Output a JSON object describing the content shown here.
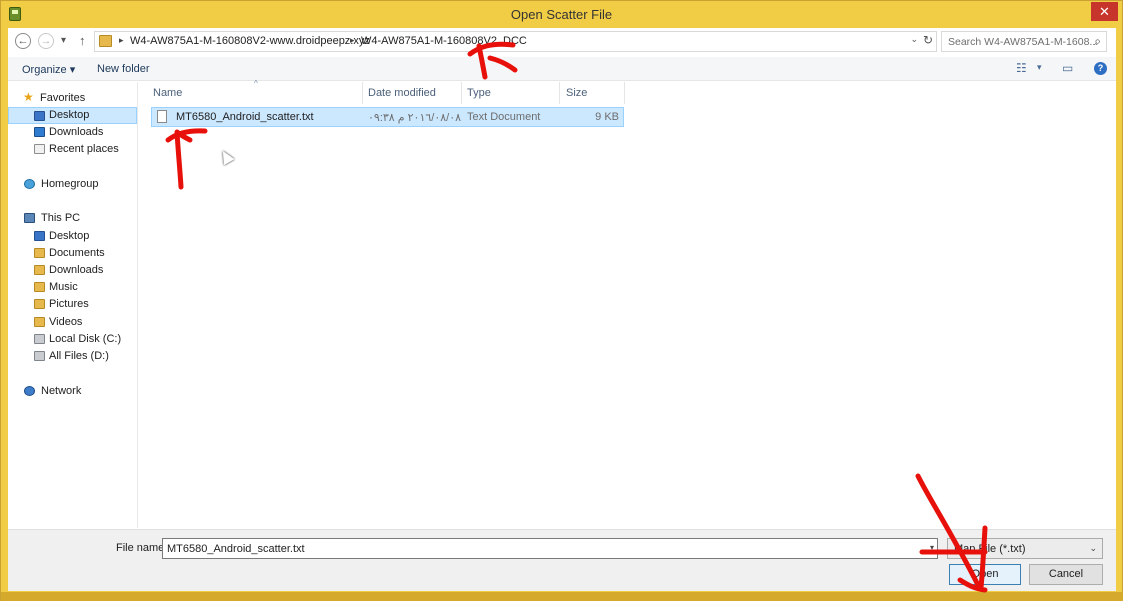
{
  "window": {
    "title": "Open Scatter File",
    "close_glyph": "✕"
  },
  "navigation": {
    "back_glyph": "←",
    "forward_glyph": "→",
    "recent_glyph": "▾",
    "up_glyph": "↑",
    "breadcrumbs": [
      "W4-AW875A1-M-160808V2-www.droidpeepz.xyz",
      "W4-AW875A1-M-160808V2_DCC"
    ],
    "crumb_separator": "▸",
    "address_dropdown_glyph": "⌄",
    "refresh_glyph": "↻",
    "search_placeholder": "Search W4-AW875A1-M-1608...",
    "search_glyph": "⌕"
  },
  "toolbar": {
    "organize_label": "Organize",
    "organize_caret": "▾",
    "new_folder_label": "New folder",
    "view_glyph": "☷",
    "view_caret": "▾",
    "preview_glyph": "▭",
    "help_glyph": "?"
  },
  "sidebar": {
    "favorites_label": "Favorites",
    "favorites": [
      "Desktop",
      "Downloads",
      "Recent places"
    ],
    "homegroup_label": "Homegroup",
    "this_pc_label": "This PC",
    "this_pc_items": [
      "Desktop",
      "Documents",
      "Downloads",
      "Music",
      "Pictures",
      "Videos",
      "Local Disk (C:)",
      "All Files (D:)"
    ],
    "network_label": "Network",
    "selected_item": "Desktop"
  },
  "file_list": {
    "columns": [
      "Name",
      "Date modified",
      "Type",
      "Size"
    ],
    "sort_glyph": "^",
    "rows": [
      {
        "name": "MT6580_Android_scatter.txt",
        "date_modified": "٢٠١٦/٠٨/٠٨ م ٠٩:٣٨",
        "type": "Text Document",
        "size": "9 KB"
      }
    ]
  },
  "footer": {
    "file_name_label": "File name:",
    "file_name_value": "MT6580_Android_scatter.txt",
    "file_name_dropdown_glyph": "▾",
    "filter_value": "Map File (*.txt)",
    "filter_dropdown_glyph": "⌄",
    "open_label": "Open",
    "cancel_label": "Cancel"
  },
  "annotation_color": "#e8100a"
}
